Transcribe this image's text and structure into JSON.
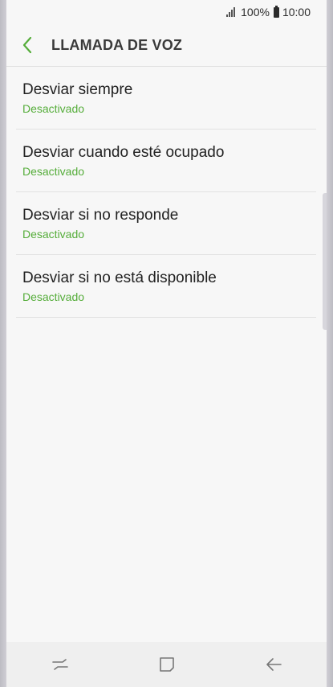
{
  "status_bar": {
    "battery_text": "100%",
    "time": "10:00",
    "icons": [
      "signal-icon",
      "battery-icon"
    ]
  },
  "header": {
    "title": "LLAMADA DE VOZ",
    "back_icon": "chevron-left-icon"
  },
  "items": [
    {
      "title": "Desviar siempre",
      "status": "Desactivado"
    },
    {
      "title": "Desviar cuando esté ocupado",
      "status": "Desactivado"
    },
    {
      "title": "Desviar si no responde",
      "status": "Desactivado"
    },
    {
      "title": "Desviar si no está disponible",
      "status": "Desactivado"
    }
  ],
  "nav_bar": {
    "icons": [
      "recent-apps-icon",
      "home-icon",
      "back-icon"
    ]
  },
  "colors": {
    "accent": "#55ad3a",
    "background": "#f7f7f7"
  }
}
